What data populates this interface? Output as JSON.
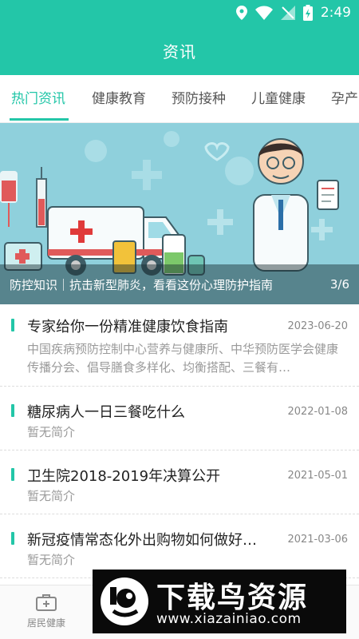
{
  "status": {
    "time": "2:49"
  },
  "header": {
    "title": "资讯"
  },
  "tabs": [
    {
      "label": "热门资讯",
      "active": true
    },
    {
      "label": "健康教育",
      "active": false
    },
    {
      "label": "预防接种",
      "active": false
    },
    {
      "label": "儿童健康",
      "active": false
    },
    {
      "label": "孕产",
      "active": false
    }
  ],
  "banner": {
    "caption": "防控知识｜抗击新型肺炎，看看这份心理防护指南",
    "counter": "3/6"
  },
  "news": [
    {
      "title": "专家给你一份精准健康饮食指南",
      "date": "2023-06-20",
      "summary": "中国疾病预防控制中心营养与健康所、中华预防医学会健康传播分会、倡导膳食多样化、均衡搭配、三餐有…"
    },
    {
      "title": "糖尿病人一日三餐吃什么",
      "date": "2022-01-08",
      "summary": "暂无简介"
    },
    {
      "title": "卫生院2018-2019年决算公开",
      "date": "2021-05-01",
      "summary": "暂无简介"
    },
    {
      "title": "新冠疫情常态化外出购物如何做好…",
      "date": "2021-03-06",
      "summary": "暂无简介"
    }
  ],
  "bottom_nav": {
    "label": "居民健康",
    "icon": "medical-kit-icon"
  },
  "watermark": {
    "title": "下载鸟资源",
    "url": "www.xiazainiao.com"
  },
  "colors": {
    "accent": "#23c6a8"
  }
}
